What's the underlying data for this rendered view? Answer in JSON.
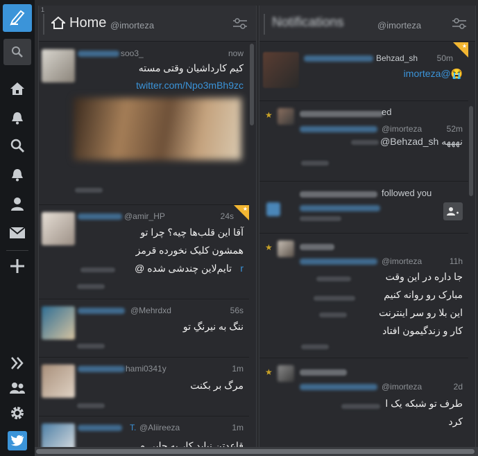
{
  "nav": {
    "items": [
      {
        "name": "compose-icon"
      },
      {
        "name": "search-icon"
      },
      {
        "name": "home-icon"
      },
      {
        "name": "notifications-icon"
      },
      {
        "name": "search-column-icon"
      },
      {
        "name": "activity-icon"
      },
      {
        "name": "user-icon"
      },
      {
        "name": "messages-icon"
      },
      {
        "name": "add-column-icon"
      },
      {
        "name": "expand-icon"
      },
      {
        "name": "accounts-icon"
      },
      {
        "name": "settings-icon"
      },
      {
        "name": "twitter-icon"
      }
    ]
  },
  "columns": {
    "home": {
      "index": "1",
      "title": "Home",
      "handle": "@imorteza",
      "tweets": [
        {
          "handle": "soo3_",
          "time": "now",
          "text": "کیم کارداشیان وقتی مسته",
          "link": "twitter.com/Npo3mBh9zc"
        },
        {
          "handle": "@amir_HP",
          "time": "24s",
          "lines": [
            "آقا این قلب‌ها چیه؟ چرا تو",
            "همشون کلیک نخورده قرمز",
            "تایم‌لاین چندشی شده @"
          ],
          "link_tail": "r"
        },
        {
          "handle": "@Mehrdxd",
          "time": "56s",
          "text": "ننگ به نیرنگِ تو"
        },
        {
          "handle": "hami0341y",
          "time": "1m",
          "text": "مرگ بر بکنت"
        },
        {
          "prefix": "T.",
          "handle": "@Aliireeza",
          "time": "1m",
          "text": "قاعدتن نباید کار به جایی م"
        }
      ]
    },
    "notifications": {
      "title": "Notifications",
      "handle": "@imorteza",
      "items": [
        {
          "handle": "Behzad_sh",
          "time": "50m",
          "text": "imorteza@😭"
        },
        {
          "tail": "ed",
          "handle": "@imorteza",
          "time": "52m",
          "text": "@Behzad_sh نهههه"
        },
        {
          "action": "followed you"
        },
        {
          "handle": "@imorteza",
          "time": "11h",
          "lines": [
            "جا داره در این وقت",
            "مبارک رو روانه کنیم",
            "این بلا رو سر اینترنت",
            "کار و زندگیمون افتاد"
          ]
        },
        {
          "handle": "@imorteza",
          "time": "2d",
          "lines": [
            "طرف تو شبکه یک ا",
            "کرد"
          ]
        }
      ]
    }
  }
}
